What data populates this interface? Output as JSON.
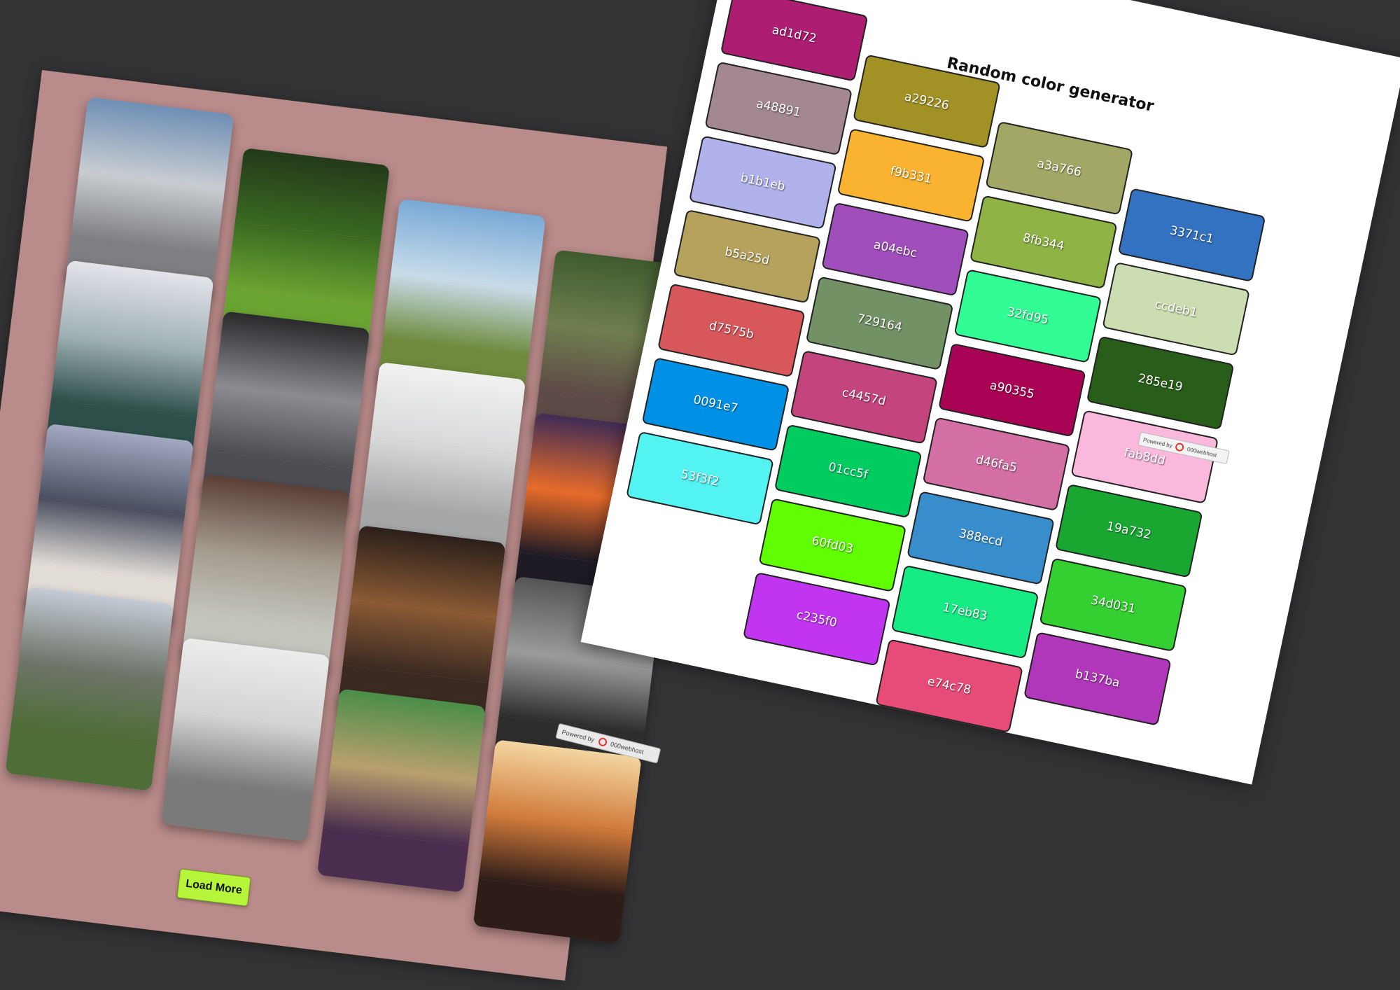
{
  "gallery": {
    "load_more_label": "Load More",
    "powered_by": "Powered by",
    "host_name": "000webhost",
    "photos": [
      {
        "name": "photo-snowy-mountains",
        "colors": [
          "#6e8fb5",
          "#c9cdd2",
          "#7e7f82"
        ]
      },
      {
        "name": "photo-forest",
        "colors": [
          "#23391a",
          "#3a6a21",
          "#6aa431"
        ]
      },
      {
        "name": "photo-pineapple-field",
        "colors": [
          "#79a9d6",
          "#c8dcea",
          "#6f8a3c"
        ]
      },
      {
        "name": "photo-green-path",
        "colors": [
          "#3f5b2e",
          "#6f7e4e",
          "#5e4a47"
        ]
      },
      {
        "name": "photo-foggy-lake",
        "colors": [
          "#e3e4ea",
          "#9fb0b3",
          "#2e4f4a"
        ]
      },
      {
        "name": "photo-water-drops",
        "colors": [
          "#2a2a2d",
          "#8b8b90",
          "#4d4d52"
        ]
      },
      {
        "name": "photo-sea-buoy",
        "colors": [
          "#f1f1f1",
          "#d8d9da",
          "#a6a7a8"
        ]
      },
      {
        "name": "photo-sunset-coast",
        "colors": [
          "#3f2c55",
          "#e86b2a",
          "#1e1b25"
        ]
      },
      {
        "name": "photo-city-skyline",
        "colors": [
          "#a2a9c2",
          "#4a4f60",
          "#e1dcd6"
        ]
      },
      {
        "name": "photo-subway-floor",
        "colors": [
          "#5b3f36",
          "#a49b8f",
          "#c3c5bd"
        ]
      },
      {
        "name": "photo-cafe-interior",
        "colors": [
          "#2b1f1a",
          "#8a5a34",
          "#3b2a22"
        ]
      },
      {
        "name": "photo-bw-building",
        "colors": [
          "#555555",
          "#9b9b9b",
          "#2d2d2d"
        ]
      },
      {
        "name": "photo-castle",
        "colors": [
          "#c4cbd6",
          "#6d7468",
          "#4f6d37"
        ]
      },
      {
        "name": "photo-flatlay-gadgets",
        "colors": [
          "#ececec",
          "#d3d3d3",
          "#7a7a7a"
        ]
      },
      {
        "name": "photo-colorful-cafe",
        "colors": [
          "#4a8d48",
          "#b9a06e",
          "#4b2e4f"
        ]
      },
      {
        "name": "photo-train-sunset",
        "colors": [
          "#f4d6a1",
          "#d07a3a",
          "#2d1c18"
        ]
      }
    ]
  },
  "color_generator": {
    "title": "Random color generator",
    "powered_by": "Powered by",
    "host_name": "000webhost",
    "swatches": [
      {
        "label": "ad1d72",
        "color": "#ad1d72"
      },
      {
        "label": "a29226",
        "color": "#a29226"
      },
      {
        "label": "a48891",
        "color": "#a48891"
      },
      {
        "label": "a3a766",
        "color": "#a3a766"
      },
      {
        "label": "f9b331",
        "color": "#f9b331"
      },
      {
        "label": "3371c1",
        "color": "#3371c1"
      },
      {
        "label": "b1b1eb",
        "color": "#b1b1eb"
      },
      {
        "label": "8fb344",
        "color": "#8fb344"
      },
      {
        "label": "a04ebc",
        "color": "#a04ebc"
      },
      {
        "label": "ccdeb1",
        "color": "#ccdeb1"
      },
      {
        "label": "b5a25d",
        "color": "#b5a25d"
      },
      {
        "label": "32fd95",
        "color": "#32fd95"
      },
      {
        "label": "729164",
        "color": "#729164"
      },
      {
        "label": "285e19",
        "color": "#285e19"
      },
      {
        "label": "d7575b",
        "color": "#d7575b"
      },
      {
        "label": "a90355",
        "color": "#a90355"
      },
      {
        "label": "c4457d",
        "color": "#c4457d"
      },
      {
        "label": "fab8dd",
        "color": "#fab8dd"
      },
      {
        "label": "0091e7",
        "color": "#0091e7"
      },
      {
        "label": "d46fa5",
        "color": "#d46fa5"
      },
      {
        "label": "01cc5f",
        "color": "#01cc5f"
      },
      {
        "label": "19a732",
        "color": "#19a732"
      },
      {
        "label": "53f3f2",
        "color": "#53f3f2"
      },
      {
        "label": "388ecd",
        "color": "#388ecd"
      },
      {
        "label": "60fd03",
        "color": "#60fd03"
      },
      {
        "label": "34d031",
        "color": "#34d031"
      },
      {
        "label": "17eb83",
        "color": "#17eb83"
      },
      {
        "label": "c235f0",
        "color": "#c235f0"
      },
      {
        "label": "b137ba",
        "color": "#b137ba"
      },
      {
        "label": "e74c78",
        "color": "#e74c78"
      }
    ]
  }
}
